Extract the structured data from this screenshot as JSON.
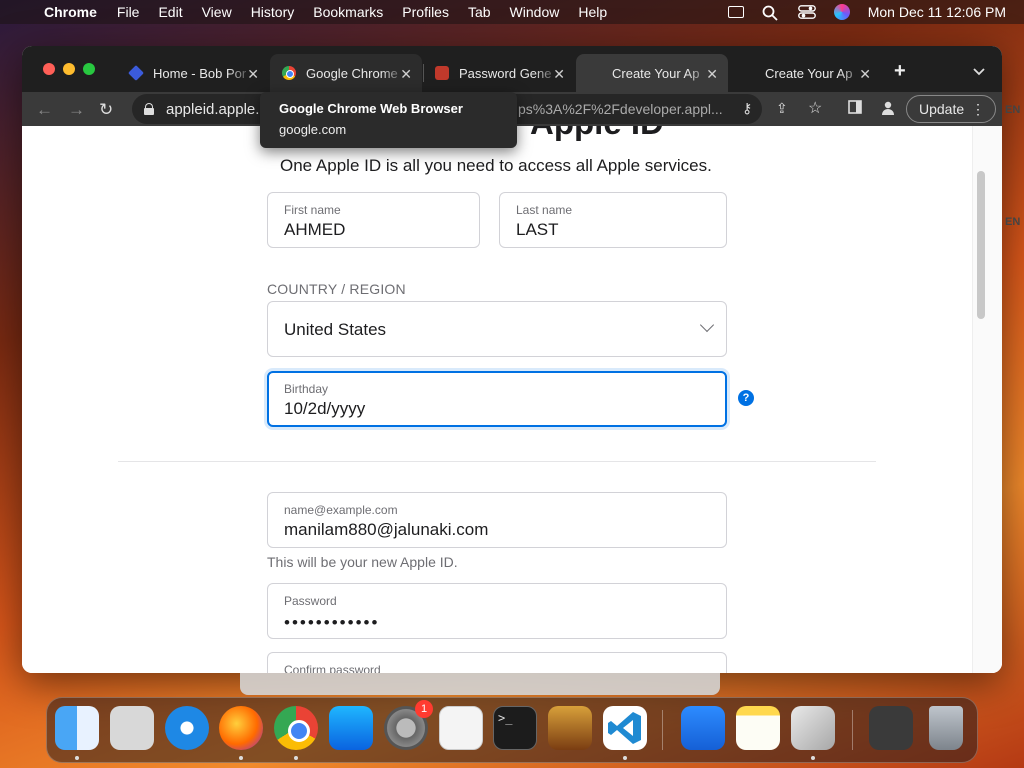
{
  "menubar": {
    "app_name": "Chrome",
    "menus": [
      "File",
      "Edit",
      "View",
      "History",
      "Bookmarks",
      "Profiles",
      "Tab",
      "Window",
      "Help"
    ],
    "clock": "Mon Dec 11  12:06 PM"
  },
  "tabs": [
    {
      "title": "Home - Bob Por",
      "icon": "bob-favicon"
    },
    {
      "title": "Google Chrome",
      "icon": "chrome-favicon"
    },
    {
      "title": "Password Gene",
      "icon": "password-favicon"
    },
    {
      "title": "Create Your Ap",
      "icon": "apple-favicon",
      "active": true
    },
    {
      "title": "Create Your Ap",
      "icon": "apple-favicon"
    }
  ],
  "toolbar": {
    "url": "appleid.apple.c",
    "url_tail": "ps%3A%2F%2Fdeveloper.appl...",
    "update_label": "Update"
  },
  "tooltip": {
    "title": "Google Chrome Web Browser",
    "subtitle": "google.com"
  },
  "form": {
    "heading": "Apple ID",
    "subtitle": "One Apple ID is all you need to access all Apple services.",
    "first_name": {
      "label": "First name",
      "value": "AHMED"
    },
    "last_name": {
      "label": "Last name",
      "value": "LAST"
    },
    "country_label": "COUNTRY / REGION",
    "country_value": "United States",
    "birthday": {
      "label": "Birthday",
      "value": "10/2d/yyyy"
    },
    "help_glyph": "?",
    "email": {
      "label": "name@example.com",
      "value": "manilam880@jalunaki.com"
    },
    "email_hint": "This will be your new Apple ID.",
    "password": {
      "label": "Password",
      "value": "••••••••••••"
    },
    "confirm_password": {
      "label": "Confirm password"
    }
  },
  "dock": {
    "settings_badge": "1",
    "terminal_prompt": ">_"
  },
  "side_labels": [
    "EN",
    "EN"
  ]
}
